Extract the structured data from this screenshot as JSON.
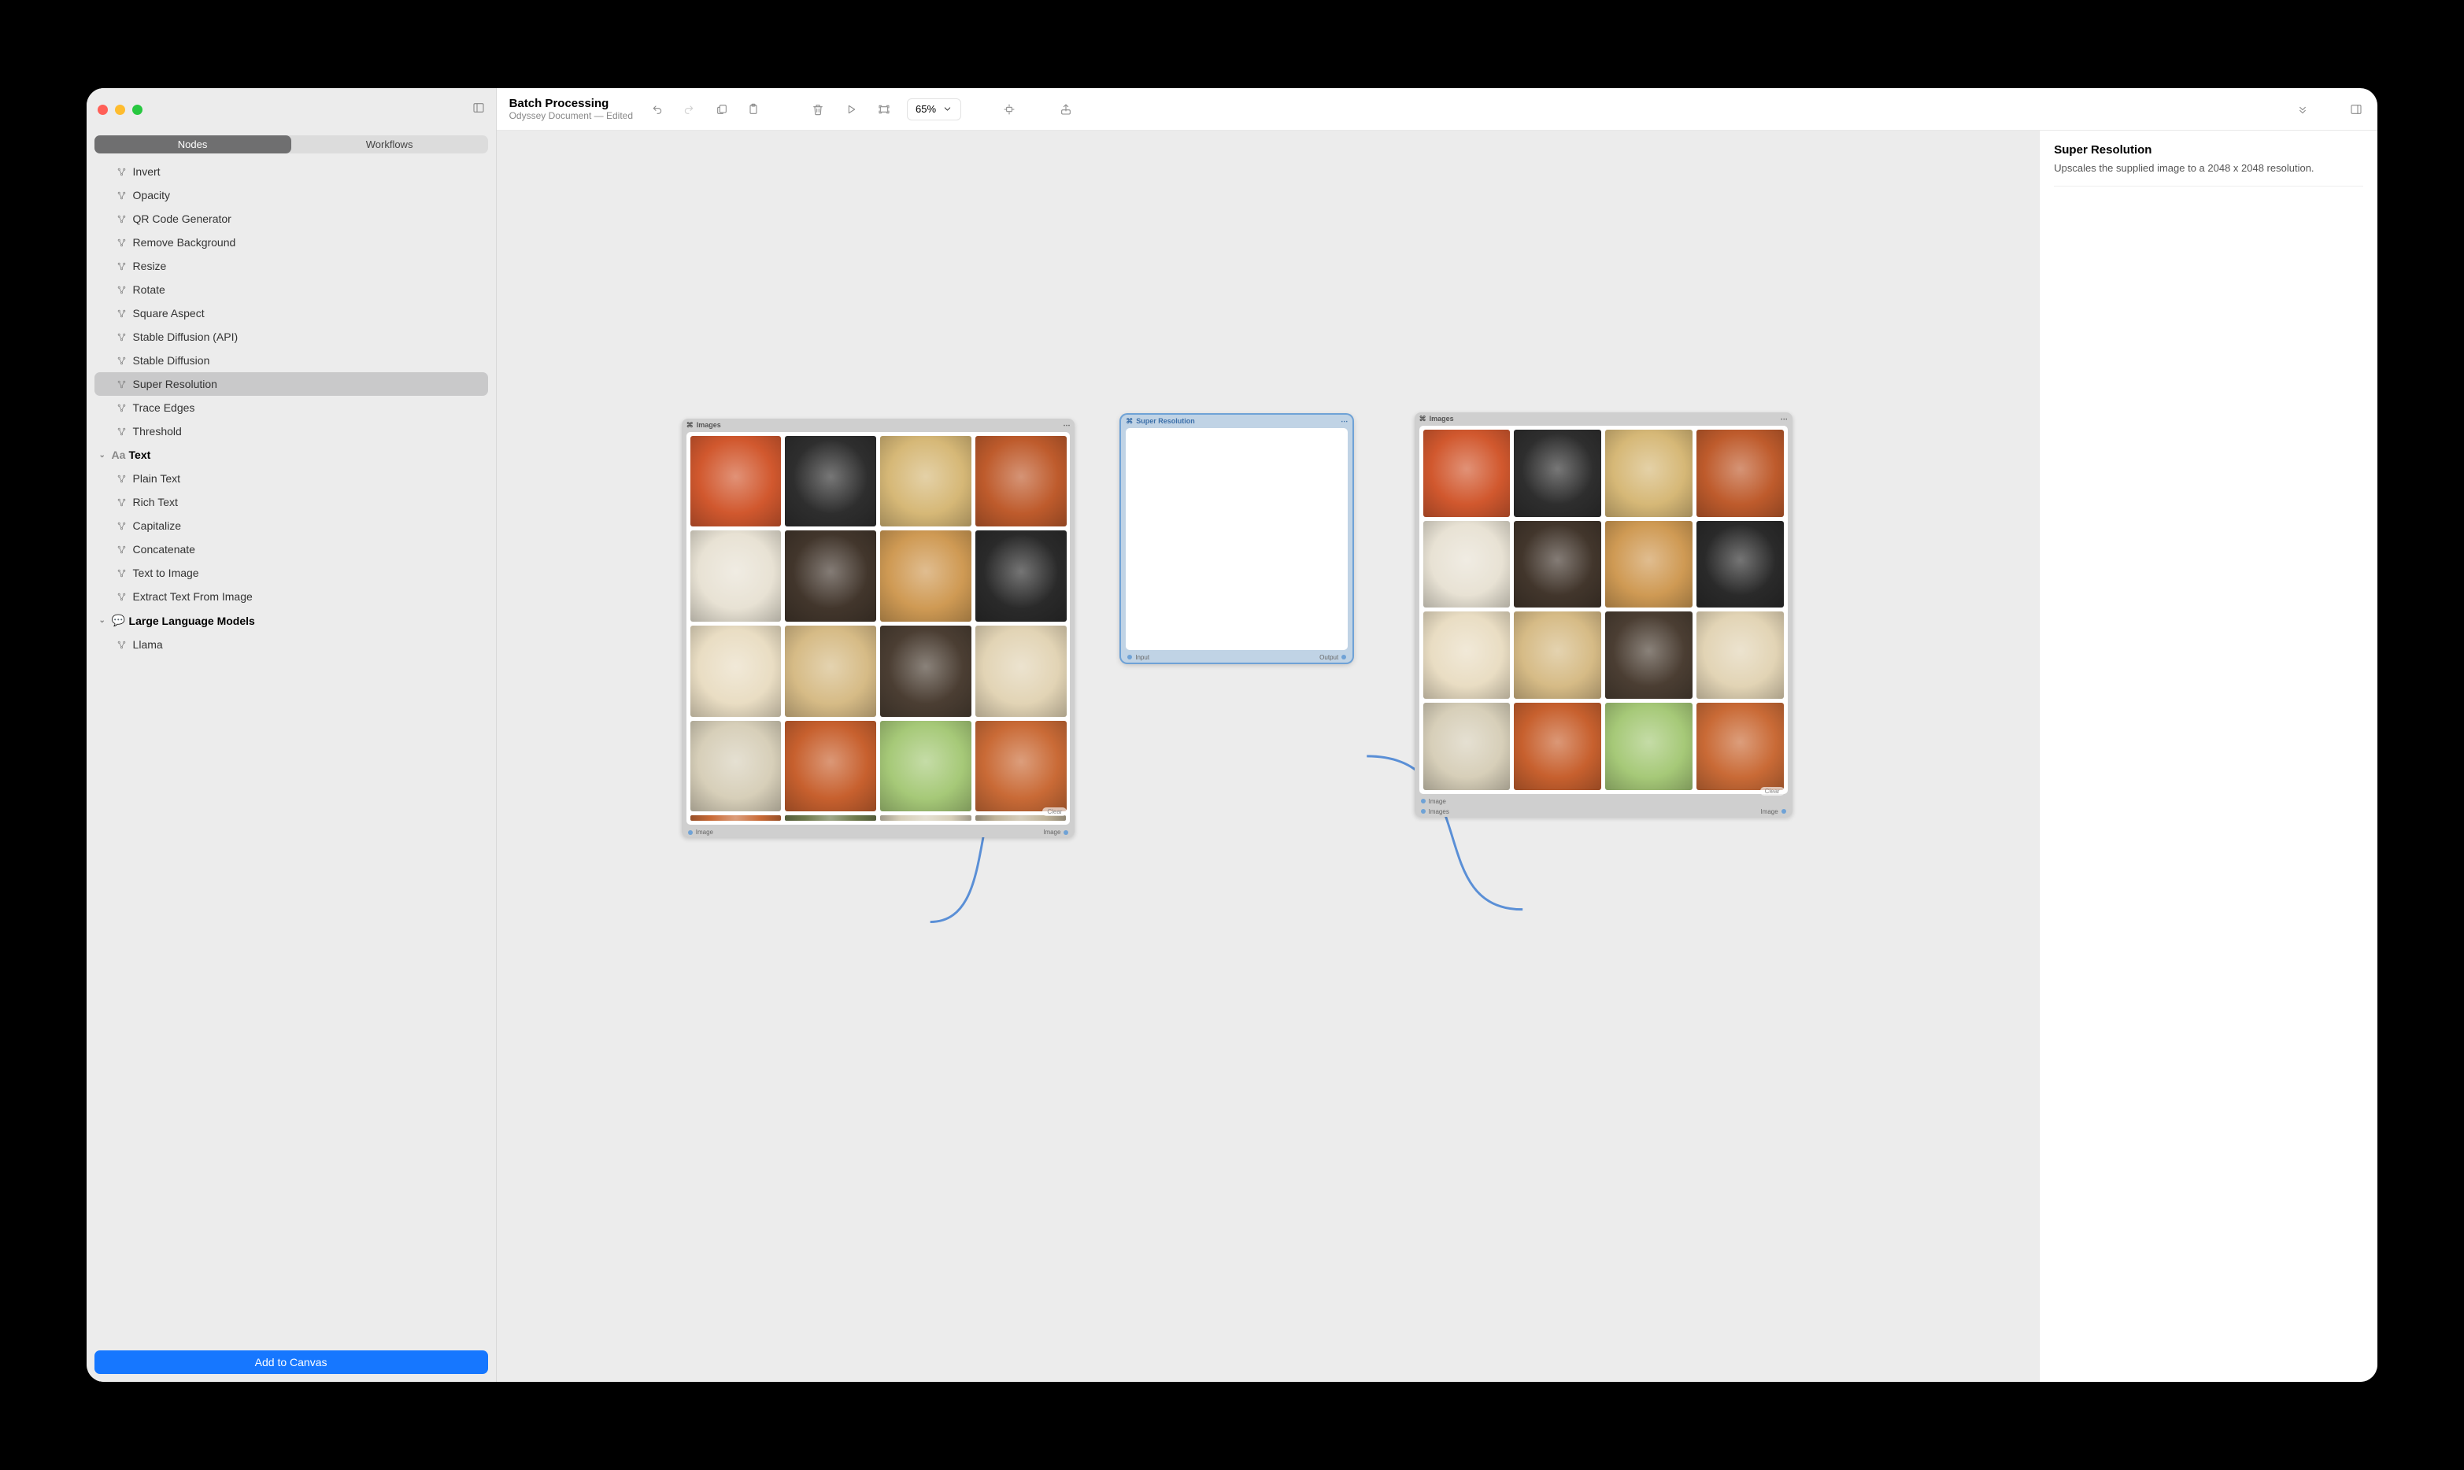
{
  "header": {
    "title": "Batch Processing",
    "subtitle": "Odyssey Document — Edited",
    "zoom": "65%"
  },
  "sidebar": {
    "tabs": {
      "nodes": "Nodes",
      "workflows": "Workflows"
    },
    "nodes": [
      "Invert",
      "Opacity",
      "QR Code Generator",
      "Remove Background",
      "Resize",
      "Rotate",
      "Square Aspect",
      "Stable Diffusion (API)",
      "Stable Diffusion",
      "Super Resolution",
      "Trace Edges",
      "Threshold"
    ],
    "selected": "Super Resolution",
    "groups": [
      {
        "label": "Text",
        "icon": "Aa",
        "items": [
          "Plain Text",
          "Rich Text",
          "Capitalize",
          "Concatenate",
          "Text to Image",
          "Extract Text From Image"
        ]
      },
      {
        "label": "Large Language Models",
        "icon": "💬",
        "items": [
          "Llama"
        ]
      }
    ],
    "add_button": "Add to Canvas"
  },
  "inspector": {
    "title": "Super Resolution",
    "description": "Upscales the supplied image to a 2048 x 2048 resolution."
  },
  "canvas": {
    "node_images_left": {
      "title": "Images",
      "clear": "Clear",
      "ports": {
        "in": "Image",
        "out": "Image"
      },
      "grid_colors": [
        "#d1582e",
        "#2e2e2e",
        "#d6b877",
        "#be5b2c",
        "#e8e2d4",
        "#42362c",
        "#cf9a54",
        "#2a2a2a",
        "#e9ddc3",
        "#d6bb86",
        "#4b3e33",
        "#e2d4b5",
        "#d7cfb9",
        "#c7602e",
        "#a6c978",
        "#c96a36"
      ],
      "strip_colors": [
        "#c96a36",
        "#6f7a4d",
        "#d7cfb9",
        "#c0b49a"
      ]
    },
    "node_super": {
      "title": "Super Resolution",
      "ports": {
        "in": "Input",
        "out": "Output"
      }
    },
    "node_images_right": {
      "title": "Images",
      "clear": "Clear",
      "ports": {
        "in": "Image",
        "in2": "Images",
        "out": "Image"
      },
      "grid_colors": [
        "#d1582e",
        "#2e2e2e",
        "#d6b877",
        "#be5b2c",
        "#e8e2d4",
        "#42362c",
        "#cf9a54",
        "#2a2a2a",
        "#e9ddc3",
        "#d6bb86",
        "#4b3e33",
        "#e2d4b5",
        "#d7cfb9",
        "#c7602e",
        "#a6c978",
        "#c96a36"
      ]
    }
  }
}
